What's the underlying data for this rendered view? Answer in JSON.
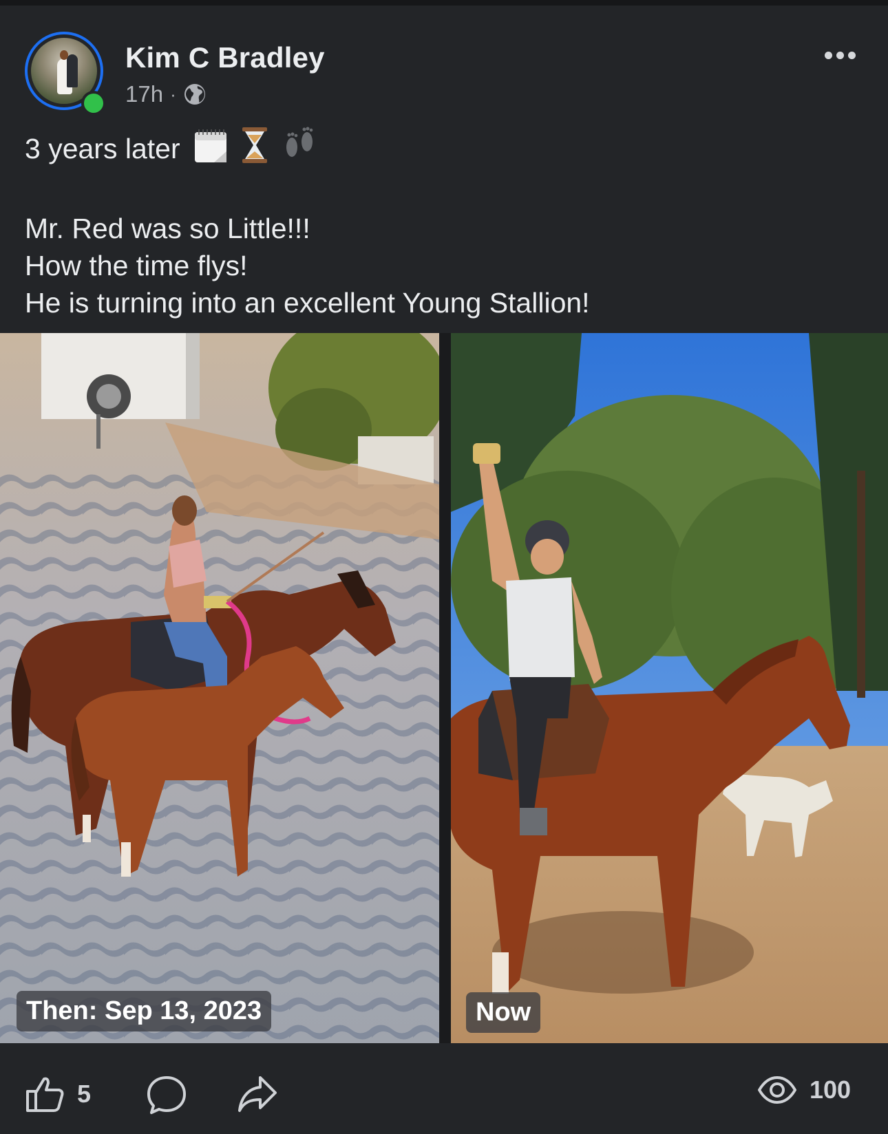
{
  "post": {
    "author": "Kim C Bradley",
    "time": "17h",
    "separator": "·",
    "visibility_icon": "globe-icon",
    "caption_lines": [
      "3 years later",
      "",
      "Mr. Red was so Little!!!",
      "How the time flys!",
      "He is turning into an excellent Young Stallion!"
    ],
    "caption_emojis": [
      "calendar-emoji",
      "hourglass-emoji",
      "footprints-emoji"
    ],
    "photos": [
      {
        "label": "Then: Sep 13, 2023"
      },
      {
        "label": "Now"
      }
    ],
    "actions": {
      "like_count": "5",
      "views_count": "100"
    }
  },
  "colors": {
    "background": "#232528",
    "text": "#eceef0",
    "muted": "#b0b3b8",
    "ring": "#1d6ff2",
    "online": "#31c04a"
  }
}
